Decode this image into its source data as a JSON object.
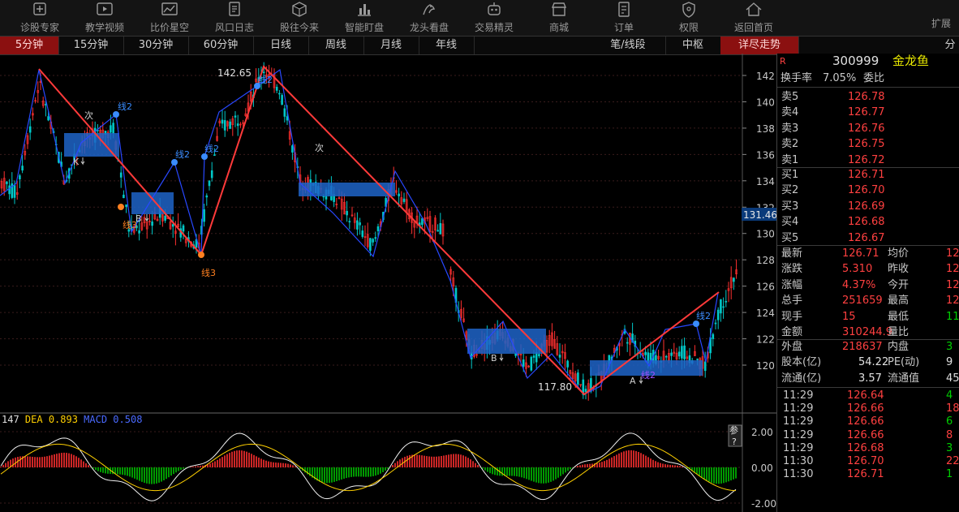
{
  "toolbar": {
    "items": [
      {
        "label": "诊股专家",
        "icon": "plus-box-icon"
      },
      {
        "label": "教学视频",
        "icon": "play-icon"
      },
      {
        "label": "比价星空",
        "icon": "chart-icon"
      },
      {
        "label": "风口日志",
        "icon": "document-icon"
      },
      {
        "label": "股往今来",
        "icon": "cube-icon"
      },
      {
        "label": "智能盯盘",
        "icon": "bar-chart-icon"
      },
      {
        "label": "龙头看盘",
        "icon": "dragon-icon"
      },
      {
        "label": "交易精灵",
        "icon": "robot-icon"
      },
      {
        "label": "商城",
        "icon": "store-icon"
      },
      {
        "label": "订单",
        "icon": "order-icon"
      },
      {
        "label": "权限",
        "icon": "shield-icon"
      },
      {
        "label": "返回首页",
        "icon": "home-icon"
      }
    ],
    "expand_label": "扩展"
  },
  "tabs": {
    "periods": [
      "5分钟",
      "15分钟",
      "30分钟",
      "60分钟",
      "日线",
      "周线",
      "月线",
      "年线"
    ],
    "active": "5分钟",
    "right": [
      "笔/线段",
      "中枢",
      "详尽走势"
    ],
    "right_active": "详尽走势",
    "edge": "分"
  },
  "chart": {
    "price_ticks": [
      "142",
      "140",
      "138",
      "136",
      "134",
      "132",
      "130",
      "128",
      "126",
      "124",
      "122",
      "120"
    ],
    "current_price_tag": "131.46",
    "high_label": "142.65",
    "low_label": "117.80",
    "annotations": [
      "线2",
      "线2",
      "线2",
      "线3",
      "线3",
      "线2",
      "次",
      "次",
      "线2",
      "线2",
      "K",
      "B",
      "B",
      "A"
    ],
    "macd_legend": {
      "prefix": "147",
      "dea_label": "DEA",
      "dea_value": "0.893",
      "macd_label": "MACD",
      "macd_value": "0.508"
    },
    "macd_ticks": [
      "2.00",
      "0.00",
      "-2.00"
    ],
    "param_button": "参?"
  },
  "quote": {
    "marker": "R",
    "code": "300999",
    "name": "金龙鱼",
    "turnover_label": "换手率",
    "turnover_value": "7.05%",
    "weibi_label": "委比",
    "sells": [
      {
        "label": "卖5",
        "price": "126.78"
      },
      {
        "label": "卖4",
        "price": "126.77"
      },
      {
        "label": "卖3",
        "price": "126.76"
      },
      {
        "label": "卖2",
        "price": "126.75"
      },
      {
        "label": "卖1",
        "price": "126.72"
      }
    ],
    "buys": [
      {
        "label": "买1",
        "price": "126.71"
      },
      {
        "label": "买2",
        "price": "126.70"
      },
      {
        "label": "买3",
        "price": "126.69"
      },
      {
        "label": "买4",
        "price": "126.68"
      },
      {
        "label": "买5",
        "price": "126.67"
      }
    ],
    "stats": [
      {
        "l1": "最新",
        "v1": "126.71",
        "l2": "均价",
        "v2": "12"
      },
      {
        "l1": "涨跌",
        "v1": "5.310",
        "l2": "昨收",
        "v2": "12"
      },
      {
        "l1": "涨幅",
        "v1": "4.37%",
        "l2": "今开",
        "v2": "12"
      },
      {
        "l1": "总手",
        "v1": "251659",
        "l2": "最高",
        "v2": "12"
      },
      {
        "l1": "现手",
        "v1": "15",
        "l2": "最低",
        "v2": "11"
      },
      {
        "l1": "金额",
        "v1": "310244.9",
        "l2": "量比",
        "v2": ""
      }
    ],
    "stats2": [
      {
        "l1": "外盘",
        "v1": "218637",
        "l2": "内盘",
        "v2": "3"
      },
      {
        "l1": "股本(亿)",
        "v1": "54.22",
        "l2": "PE(动)",
        "v2": "9"
      },
      {
        "l1": "流通(亿)",
        "v1": "3.57",
        "l2": "流通值",
        "v2": "45"
      }
    ],
    "ticks": [
      {
        "time": "11:29",
        "price": "126.64",
        "vol": "4"
      },
      {
        "time": "11:29",
        "price": "126.66",
        "vol": "18"
      },
      {
        "time": "11:29",
        "price": "126.66",
        "vol": "6"
      },
      {
        "time": "11:29",
        "price": "126.66",
        "vol": "8"
      },
      {
        "time": "11:29",
        "price": "126.68",
        "vol": "3"
      },
      {
        "time": "11:30",
        "price": "126.70",
        "vol": "22"
      },
      {
        "time": "11:30",
        "price": "126.71",
        "vol": "1"
      }
    ]
  },
  "colors": {
    "up": "#ff3030",
    "down": "#00c8c8",
    "zone": "#1e64c8",
    "bi": "#ff3a3a",
    "line": "#2848ff"
  }
}
